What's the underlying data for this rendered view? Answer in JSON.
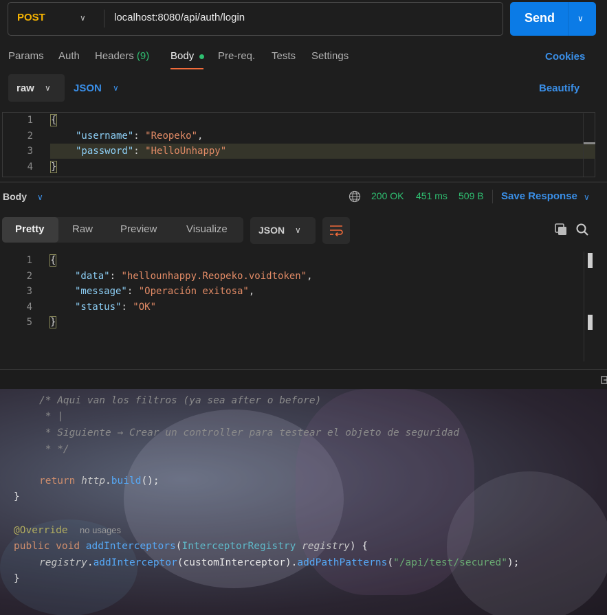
{
  "request": {
    "method": "POST",
    "url": "localhost:8080/api/auth/login",
    "send_label": "Send"
  },
  "tabs": {
    "params": "Params",
    "auth": "Auth",
    "headers": "Headers",
    "headers_count": "(9)",
    "body": "Body",
    "prereq": "Pre-req.",
    "tests": "Tests",
    "settings": "Settings",
    "cookies": "Cookies"
  },
  "body_mode": {
    "raw": "raw",
    "json": "JSON",
    "beautify": "Beautify"
  },
  "request_body": {
    "line_numbers": [
      "1",
      "2",
      "3",
      "4"
    ],
    "open_brace": "{",
    "close_brace": "}",
    "username_key": "\"username\"",
    "username_value": "\"Reopeko\"",
    "password_key": "\"password\"",
    "password_value": "\"HelloUnhappy\""
  },
  "response": {
    "body_label": "Body",
    "status": "200 OK",
    "time": "451 ms",
    "size": "509 B",
    "save_response": "Save Response",
    "views": [
      "Pretty",
      "Raw",
      "Preview",
      "Visualize"
    ],
    "format": "JSON",
    "line_numbers": [
      "1",
      "2",
      "3",
      "4",
      "5"
    ],
    "open_brace": "{",
    "close_brace": "}",
    "data_key": "\"data\"",
    "data_value": "\"hellounhappy.Reopeko.voidtoken\"",
    "message_key": "\"message\"",
    "message_value": "\"Operación exitosa\"",
    "status_key": "\"status\"",
    "status_value": "\"OK\""
  },
  "ide": {
    "comment1": "/* Aqui van los filtros (ya sea after o before)",
    "comment2": " * |",
    "comment3": " * Siguiente → Crear un controller para testear el objeto de seguridad",
    "comment4": " * */",
    "return_kw": "return",
    "return_obj": "http",
    "return_call": "build",
    "close1": "}",
    "annotation": "@Override",
    "usage_hint": "no usages",
    "public_kw": "public",
    "void_kw": "void",
    "method_name": "addInterceptors",
    "param_type": "InterceptorRegistry",
    "param_name": "registry",
    "body_obj": "registry",
    "body_call1": "addInterceptor",
    "body_arg": "customInterceptor",
    "body_call2": "addPathPatterns",
    "body_str": "\"/api/test/secured\"",
    "close2": "}"
  },
  "icons": [
    "chevron-down-icon",
    "globe-icon",
    "wrap-lines-icon",
    "copy-icon",
    "search-icon"
  ],
  "colors": {
    "accent_blue": "#0b7be6",
    "method_post": "#f5b301",
    "status_green": "#2fbf71",
    "active_tab_underline": "#f26b3a"
  }
}
